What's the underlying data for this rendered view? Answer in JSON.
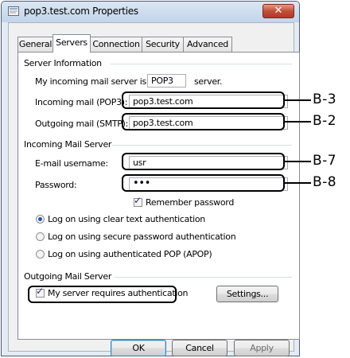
{
  "window": {
    "title": "pop3.test.com Properties",
    "close_glyph": "✕"
  },
  "tabs": [
    {
      "label": "General"
    },
    {
      "label": "Servers",
      "active": true
    },
    {
      "label": "Connection"
    },
    {
      "label": "Security"
    },
    {
      "label": "Advanced"
    }
  ],
  "server_info": {
    "heading": "Server Information",
    "incoming_type_prefix": "My incoming mail server is a",
    "incoming_type_value": "POP3",
    "incoming_type_suffix": "server.",
    "incoming_label": "Incoming mail (POP3):",
    "incoming_value": "pop3.test.com",
    "outgoing_label": "Outgoing mail (SMTP):",
    "outgoing_value": "pop3.test.com"
  },
  "incoming_server": {
    "heading": "Incoming Mail Server",
    "username_label": "E-mail username:",
    "username_value": "usr",
    "password_label": "Password:",
    "password_value": "•••",
    "remember_label": "Remember password",
    "remember_checked": true,
    "auth_options": [
      {
        "label": "Log on using clear text authentication",
        "selected": true
      },
      {
        "label": "Log on using secure password authentication",
        "selected": false
      },
      {
        "label": "Log on using authenticated POP (APOP)",
        "selected": false
      }
    ]
  },
  "outgoing_server": {
    "heading": "Outgoing Mail Server",
    "requires_auth_label": "My server requires authentication",
    "requires_auth_checked": true,
    "settings_label": "Settings..."
  },
  "footer": {
    "ok_label": "OK",
    "cancel_label": "Cancel",
    "apply_label": "Apply"
  },
  "callouts": {
    "b3": "B-3",
    "b2": "B-2",
    "b7": "B-7",
    "b8": "B-8"
  },
  "checkmark_glyph": "✓"
}
